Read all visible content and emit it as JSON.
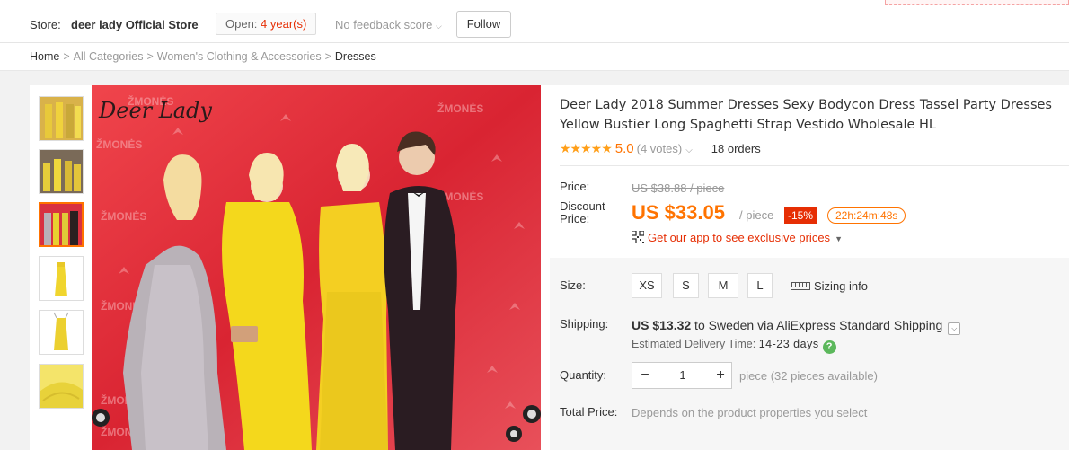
{
  "store": {
    "label": "Store:",
    "name": "deer lady Official Store",
    "open_prefix": "Open: ",
    "open_years": "4 year(s)",
    "feedback": "No feedback score",
    "follow_label": "Follow"
  },
  "breadcrumb": {
    "items": [
      "Home",
      "All Categories",
      "Women's Clothing & Accessories",
      "Dresses"
    ],
    "separator": ">"
  },
  "product": {
    "title": "Deer Lady 2018 Summer Dresses Sexy Bodycon Dress Tassel Party Dresses Yellow Bustier Long Spaghetti Strap Vestido Wholesale HL",
    "stars": "★★★★★",
    "score": "5.0",
    "votes": "(4 votes)",
    "orders": "18 orders",
    "image_logo": "Deer Lady",
    "image_backdrop_text": "ŽMONĖS"
  },
  "price": {
    "price_label": "Price:",
    "original": "US $38.88 / piece",
    "discount_label": "Discount Price:",
    "discount": "US $33.05",
    "per": "/ piece",
    "percent_off": "-15%",
    "countdown": "22h:24m:48s",
    "app_link": "Get our app to see exclusive prices"
  },
  "size": {
    "label": "Size:",
    "options": [
      "XS",
      "S",
      "M",
      "L"
    ],
    "sizing_info": "Sizing info"
  },
  "shipping": {
    "label": "Shipping:",
    "cost": "US $13.32",
    "to": " to Sweden via AliExpress Standard Shipping",
    "est_label": "Estimated Delivery Time: ",
    "est_days": "14-23 days"
  },
  "quantity": {
    "label": "Quantity:",
    "value": "1",
    "available": "piece (32 pieces available)"
  },
  "total": {
    "label": "Total Price:",
    "text": "Depends on the product properties you select"
  },
  "colors": {
    "accent": "#ff7300",
    "red": "#e62e04",
    "star": "#ff9f1a"
  }
}
